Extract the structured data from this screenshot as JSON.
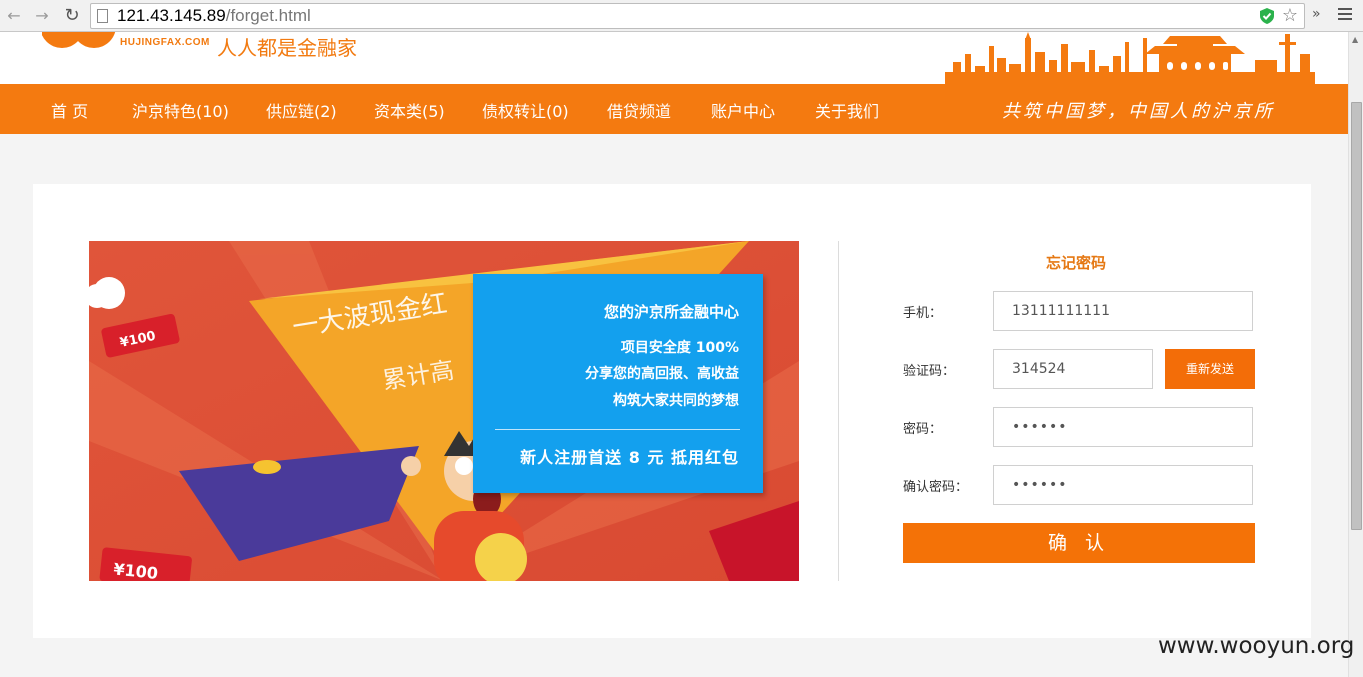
{
  "browser": {
    "url_host": "121.43.145.89",
    "url_path": "/forget.html",
    "more_label": "»"
  },
  "header": {
    "logo_domain": "HUJINGFAX.COM",
    "slogan": "人人都是金融家"
  },
  "nav": {
    "items": [
      {
        "label": "首 页"
      },
      {
        "label": "沪京特色(10)"
      },
      {
        "label": "供应链(2)"
      },
      {
        "label": "资本类(5)"
      },
      {
        "label": "债权转让(0)"
      },
      {
        "label": "借贷频道"
      },
      {
        "label": "账户中心"
      },
      {
        "label": "关于我们"
      }
    ],
    "motto": "共筑中国梦，中国人的沪京所"
  },
  "banner": {
    "headline_1": "一大波现金红",
    "headline_2": "累计高",
    "coupon_1": "¥100",
    "coupon_2": "¥100"
  },
  "info_box": {
    "title": "您的沪京所金融中心",
    "line_1": "项目安全度 100%",
    "line_2": "分享您的高回报、高收益",
    "line_3": "构筑大家共同的梦想",
    "promo": "新人注册首送 8 元 抵用红包"
  },
  "form": {
    "title": "忘记密码",
    "phone_label": "手机：",
    "phone_value": "13111111111",
    "code_label": "验证码：",
    "code_value": "314524",
    "resend_label": "重新发送",
    "password_label": "密码：",
    "password_value": "••••••",
    "confirm_password_label": "确认密码：",
    "confirm_password_value": "••••••",
    "submit_label": "确 认"
  },
  "watermark": "www.wooyun.org",
  "colors": {
    "brand_orange": "#f47a10",
    "info_blue": "#13a0ee"
  }
}
